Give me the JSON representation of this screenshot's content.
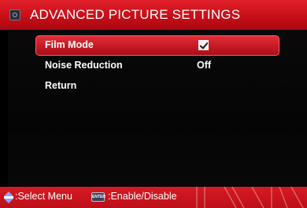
{
  "header": {
    "title": "ADVANCED PICTURE SETTINGS",
    "icon": "tv-settings-icon",
    "color": "#d0141e"
  },
  "menu": {
    "items": [
      {
        "label": "Film Mode",
        "type": "checkbox",
        "checked": true,
        "selected": true
      },
      {
        "label": "Noise Reduction",
        "type": "value",
        "value": "Off",
        "selected": false
      },
      {
        "label": "Return",
        "type": "action",
        "selected": false
      }
    ]
  },
  "footer": {
    "nav_hint": ":Select Menu",
    "enter_key": "ENTER",
    "enter_hint": ":Enable/Disable",
    "color": "#c8121c"
  }
}
